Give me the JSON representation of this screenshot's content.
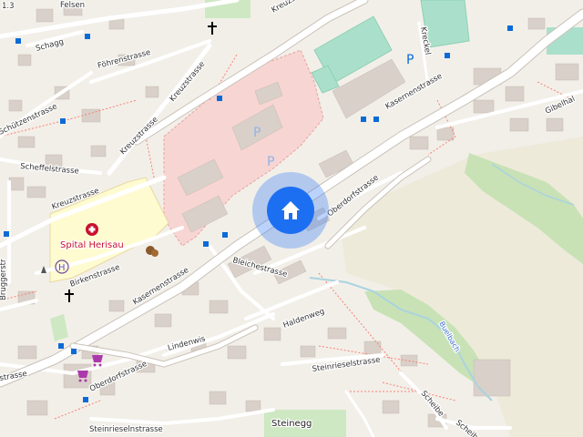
{
  "map": {
    "corner_label": "1.3",
    "location_marker": {
      "icon": "home-icon",
      "color": "#3b82f6"
    },
    "pois": {
      "hospital": {
        "label": "Spital Herisau",
        "icon": "hospital-icon"
      },
      "heliport_letter": "H",
      "parking_letter": "P"
    },
    "streets": {
      "felsen": "Felsen",
      "schagg": "Schagg",
      "foehren": "Föhrenstrasse",
      "kreuz_upper": "Kreuzstrasse",
      "kreuz_lower": "Kreuzstrasse",
      "kreuz_left": "Kreuzstrasse",
      "kreuz_top": "Kreuzstrasse",
      "schuetzen": "Schützenstrasse",
      "scheffel": "Scheffelstrasse",
      "kasernen_upper": "Kasernenstrasse",
      "kasernen_lower": "Kasernenstrasse",
      "kreckel": "Kreckel",
      "gibelhalde": "Gibelhal",
      "oberdorf_upper": "Oberdorfstrasse",
      "oberdorf_lower": "Oberdorfstrasse",
      "birken": "Birkenstrasse",
      "bleiche": "Bleichestrasse",
      "halden": "Haldenweg",
      "linden": "Lindenwis",
      "steinriesel_lower": "Steinrieselnstrasse",
      "steinriesel_upper": "Steinrieselstrasse",
      "scheibe1": "Scheibe",
      "scheibe2": "Scheibe",
      "steinegg": "Steinegg",
      "left_strasse": "strasse",
      "left_vertical": "Bruggerstr",
      "buelbach": "Buelbach"
    },
    "colors": {
      "background": "#f2efe9",
      "main_road": "#ffffff",
      "building": "#d9d0c9",
      "hospital_area": "#fffbd1",
      "pink_area": "#f7d5d2",
      "pitch": "#aae0cb",
      "forest": "#add19e",
      "meadow": "#eeeada",
      "water": "#aad3df",
      "marker": "#3b82f6"
    }
  }
}
